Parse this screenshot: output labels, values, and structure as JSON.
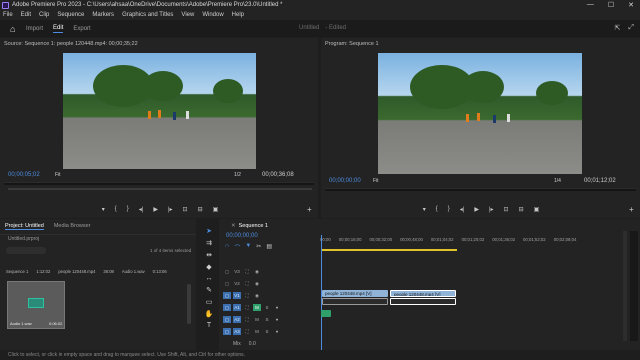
{
  "window": {
    "title": "Adobe Premiere Pro 2023 - C:\\Users\\ahsaa\\OneDrive\\Documents\\Adobe\\Premiere Pro\\23.0\\Untitled *",
    "controls": [
      "—",
      "☐",
      "✕"
    ]
  },
  "menu": [
    "File",
    "Edit",
    "Clip",
    "Sequence",
    "Markers",
    "Graphics and Titles",
    "View",
    "Window",
    "Help"
  ],
  "workspace": {
    "tabs": [
      "Import",
      "Edit",
      "Export"
    ],
    "active_tab": "Edit",
    "project_title": "Untitled",
    "edited_label": "- Edited"
  },
  "source": {
    "header": "Source: Sequence 1: people 120448.mp4: 00;00;35;22",
    "current_tc": "00;00;05;02",
    "fit": "Fit",
    "ratio": "1/2",
    "duration_tc": "00;00;36;08"
  },
  "program": {
    "header": "Program: Sequence 1",
    "current_tc": "00;00;00;00",
    "fit": "Fit",
    "ratio": "1/4",
    "duration_tc": "00;01;12;02"
  },
  "project": {
    "tabs": [
      "Project: Untitled",
      "Media Browser"
    ],
    "file": "Untitled.prproj",
    "items_selected": "1 of 4 items selected",
    "list_row": [
      "Sequence 1",
      "1:12:02",
      "people 120448.mp4",
      "36:08",
      "Audio 1.wav",
      "0:13:06"
    ],
    "thumb_label": "Audio 1.wav",
    "thumb_duration": "0:06:02"
  },
  "timeline": {
    "sequence_tab": "Sequence 1",
    "current_tc": "00;00;00;00",
    "ruler": [
      "00;00",
      "00;00;16;00",
      "00;00;32;00",
      "00;00;48;00",
      "00;01;04;02",
      "00;01;20;02",
      "00;01;36;02",
      "00;01;52;02",
      "00;02;08;04",
      "00;02;24"
    ],
    "video_tracks": [
      "V3",
      "V2",
      "V1"
    ],
    "audio_tracks": [
      "A1",
      "A2",
      "A3"
    ],
    "mix_label": "Mix",
    "mix_value": "0.0",
    "clip_v1_a": "people 120448.mp4 [V]",
    "clip_v1_b": "people 120448.mp4 [V]"
  },
  "status": {
    "text": "Click to select, or click in empty space and drag to marquee select. Use Shift, Alt, and Ctrl for other options."
  },
  "colors": {
    "accent": "#4d8ce0",
    "clip_video": "#8fb4d8",
    "clip_audio": "#2fa06c",
    "playhead": "#4d8ce0",
    "work_area": "#e2c22a"
  }
}
